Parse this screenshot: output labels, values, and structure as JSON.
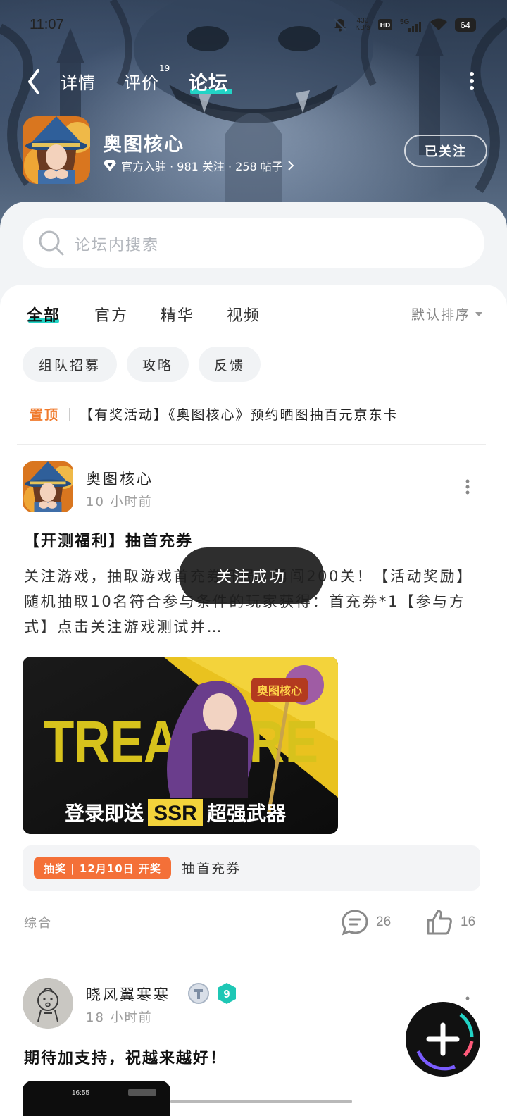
{
  "status_bar": {
    "time": "11:07",
    "net_speed_value": "430",
    "net_speed_unit": "KB/s",
    "network": "5G",
    "battery": "64"
  },
  "nav": {
    "tabs": [
      "详情",
      "评价",
      "论坛"
    ],
    "review_count": "19",
    "active_tab": "论坛"
  },
  "game": {
    "name": "奥图核心",
    "meta": "官方入驻 · 981 关注 · 258 帖子",
    "follow_label": "已关注"
  },
  "search": {
    "placeholder": "论坛内搜索"
  },
  "filter_tabs": [
    "全部",
    "官方",
    "精华",
    "视频"
  ],
  "sort_label": "默认排序",
  "chips": [
    "组队招募",
    "攻略",
    "反馈"
  ],
  "pinned": {
    "tag": "置顶",
    "title": "【有奖活动】《奥图核心》预约晒图抽百元京东卡"
  },
  "post1": {
    "author": "奥图核心",
    "time": "10 小时前",
    "title": "【开测福利】抽首充券",
    "body": "关注游戏，抽取游戏首充券开局，勇闯200关！【活动奖励】随机抽取10名符合参与条件的玩家获得：首充券*1【参与方式】点击关注游戏测试并…",
    "banner_word": "TREASURE",
    "banner_logo": "奥图核心",
    "banner_text_before": "登录即送",
    "banner_text_ssr": "SSR",
    "banner_text_after": "超强武器",
    "lottery_badge": "抽奖 | 12月10日 开奖",
    "lottery_text": "抽首充券",
    "category": "综合",
    "comments": "26",
    "likes": "16"
  },
  "toast": "关注成功",
  "post2": {
    "author": "晓风翼寒寒",
    "time": "18 小时前",
    "title": "期待加支持，祝越来越好！",
    "level": "9",
    "thumb_time": "16:55"
  },
  "colors": {
    "accent": "#22d3c5",
    "orange": "#f47038",
    "pinned": "#f07a2c"
  }
}
